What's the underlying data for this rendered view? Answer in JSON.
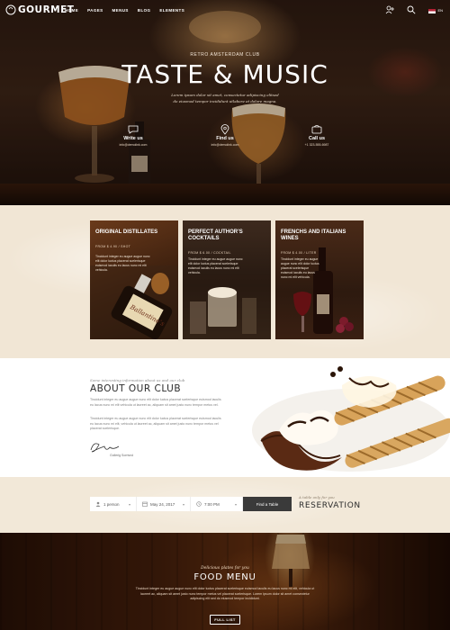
{
  "brand": {
    "logo": "GOURMET"
  },
  "nav": {
    "items": [
      {
        "label": "HOME"
      },
      {
        "label": "PAGES"
      },
      {
        "label": "MENUS"
      },
      {
        "label": "BLOG"
      },
      {
        "label": "ELEMENTS"
      }
    ],
    "lang": "EN"
  },
  "hero": {
    "subtitle": "RETRO AMSTERDAM CLUB",
    "title": "TASTE & MUSIC",
    "text": "Lorem ipsum dolor sit amet, consectetur adipiscing elitsed do eiusmod tempor incididunt utlabore et dolore magna.",
    "contacts": [
      {
        "label": "Write us",
        "value": "info@demolink.com",
        "icon": "chat-icon"
      },
      {
        "label": "Find us",
        "value": "info@demolink.com",
        "icon": "map-pin-icon"
      },
      {
        "label": "Call us",
        "value": "+1 323-555-6987",
        "icon": "phone-icon"
      }
    ]
  },
  "cards": [
    {
      "title": "Original Distillates",
      "price": "FROM $ 4.90 / SHOT",
      "text": "Tincidunt integer eu augue augue nunc elit dolor luctus placerat scelerisque euismod iaculis eu lacus nunc mi elit vehicula."
    },
    {
      "title": "Perfect author’s cocktails",
      "price": "FROM $ 6.00 / COCKTAIL",
      "text": "Tincidunt integer eu augue augue nunc elit dolor luctus placerat scelerisque euismod iaculis eu lacus nunc mi elit vehicula."
    },
    {
      "title": "Frenchs and Italians wines",
      "price": "FROM $ 4.00 / LITER",
      "text": "Tincidunt integer eu augue augue nunc elit dolor luctus placerat scelerisque euismod iaculis eu lacus nunc mi elit vehicula."
    }
  ],
  "about": {
    "kicker": "Some interesting information about us and our club",
    "title": "ABOUT OUR CLUB",
    "paragraphs": [
      "Tincidunt integer eu augue augue nunc elit dolor luctus placerat scelerisque euismod iaculis eu lacus nunc mi elit vehicula ut laoreet ac, aliquam sit amet justo nunc tempor metus vel.",
      "Tincidunt integer eu augue augue nunc elit dolor luctus placerat scelerisque euismod iaculis eu lacus nunc mi elit, vehicula ut laoreet ac, aliquam sit amet justo nunc tempor metus vel placerat scelerisque."
    ],
    "signature_name": "Gollerig Sorrisnd"
  },
  "reservation": {
    "persons": "1 person",
    "date": "May 24, 2017",
    "time": "7:00 PM",
    "button": "Find a Table",
    "kicker": "A table only for you",
    "title": "RESERVATION"
  },
  "food": {
    "kicker": "Delicious plates for you",
    "title": "FOOD MENU",
    "text": "Tincidunt integer eu augue augue nunc elit dolor luctus placerat scelerisque euismod iaculis eu lacus nunc mi elit, vehicula ut laoreet ac, aliquam sit amet justo nunc tempor metus vel placerat scelerisque. Lorem ipsum dolor sit amet consectetur adipiscing elit sed do eiusmod tempor incididunt.",
    "button": "FULL LIST"
  }
}
